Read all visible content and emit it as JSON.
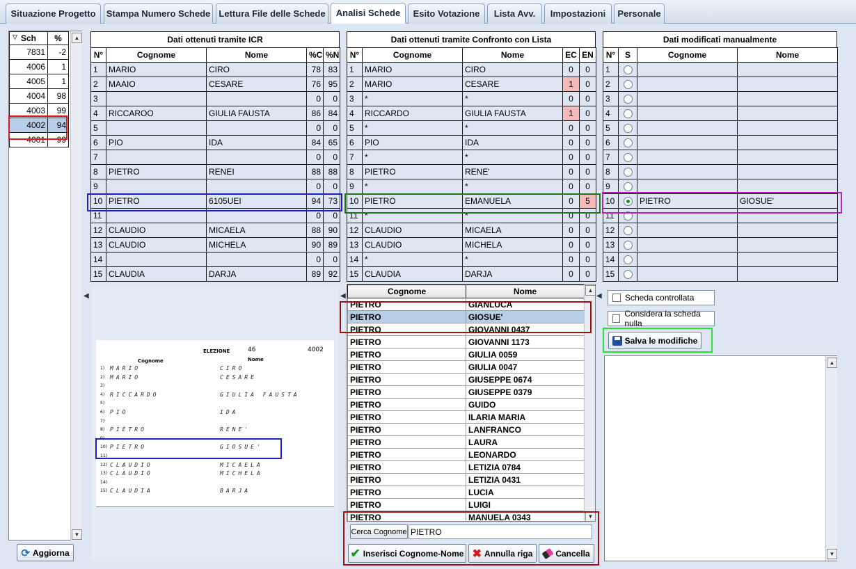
{
  "tabs": [
    "Situazione Progetto",
    "Stampa Numero Schede",
    "Lettura File delle Schede",
    "Analisi Schede",
    "Esito Votazione",
    "Lista Avv.",
    "Impostazioni",
    "Personale"
  ],
  "active_tab": "Analisi Schede",
  "left_list": {
    "headers": [
      "Sch",
      "%"
    ],
    "rows": [
      [
        "7831",
        "-2"
      ],
      [
        "4006",
        "1"
      ],
      [
        "4005",
        "1"
      ],
      [
        "4004",
        "98"
      ],
      [
        "4003",
        "99"
      ],
      [
        "4002",
        "94"
      ],
      [
        "4001",
        "99"
      ]
    ],
    "selected_index": 5,
    "refresh_label": "Aggiorna"
  },
  "icr": {
    "title": "Dati ottenuti tramite ICR",
    "headers": [
      "N°",
      "Cognome",
      "Nome",
      "%C",
      "%N"
    ],
    "rows": [
      [
        "1",
        "MARIO",
        "CIRO",
        "78",
        "83"
      ],
      [
        "2",
        "MAAIO",
        "CESARE",
        "76",
        "95"
      ],
      [
        "3",
        "",
        "",
        "0",
        "0"
      ],
      [
        "4",
        "RICCAROO",
        "GIULIA FAUSTA",
        "86",
        "84"
      ],
      [
        "5",
        "",
        "",
        "0",
        "0"
      ],
      [
        "6",
        "PIO",
        "IDA",
        "84",
        "65"
      ],
      [
        "7",
        "",
        "",
        "0",
        "0"
      ],
      [
        "8",
        "PIETRO",
        "RENEI",
        "88",
        "88"
      ],
      [
        "9",
        "",
        "",
        "0",
        "0"
      ],
      [
        "10",
        "PIETRO",
        "6105UEI",
        "94",
        "73"
      ],
      [
        "11",
        "",
        "",
        "0",
        "0"
      ],
      [
        "12",
        "CLAUDIO",
        "MICAELA",
        "88",
        "90"
      ],
      [
        "13",
        "CLAUDIO",
        "MICHELA",
        "90",
        "89"
      ],
      [
        "14",
        "",
        "",
        "0",
        "0"
      ],
      [
        "15",
        "CLAUDIA",
        "DARJA",
        "89",
        "92"
      ]
    ]
  },
  "scan": {
    "election_label": "ELEZIONE",
    "election_num": "46",
    "sheet_num": "4002",
    "col_cognome": "Cognome",
    "col_nome": "Nome",
    "lines": [
      [
        "1)",
        "MARIO",
        "CIRO"
      ],
      [
        "2)",
        "MARIO",
        "CESARE"
      ],
      [
        "3)",
        "",
        ""
      ],
      [
        "4)",
        "RICCARDO",
        "GIULIA FAUSTA"
      ],
      [
        "5)",
        "",
        ""
      ],
      [
        "6)",
        "PIO",
        "IDA"
      ],
      [
        "7)",
        "",
        ""
      ],
      [
        "8)",
        "PIETRO",
        "RENE'"
      ],
      [
        "9)",
        "",
        ""
      ],
      [
        "10)",
        "PIETRO",
        "GIOSUE'"
      ],
      [
        "11)",
        "",
        ""
      ],
      [
        "12)",
        "CLAUDIO",
        "MICAELA"
      ],
      [
        "13)",
        "CLAUDIO",
        "MICHELA"
      ],
      [
        "14)",
        "",
        ""
      ],
      [
        "15)",
        "CLAUDIA",
        "BARJA"
      ]
    ]
  },
  "compare": {
    "title": "Dati ottenuti tramite Confronto con Lista",
    "headers": [
      "N°",
      "Cognome",
      "Nome",
      "EC",
      "EN"
    ],
    "rows": [
      [
        "1",
        "MARIO",
        "CIRO",
        "0",
        "0"
      ],
      [
        "2",
        "MARIO",
        "CESARE",
        "1",
        "0"
      ],
      [
        "3",
        "*",
        "*",
        "0",
        "0"
      ],
      [
        "4",
        "RICCARDO",
        "GIULIA FAUSTA",
        "1",
        "0"
      ],
      [
        "5",
        "*",
        "*",
        "0",
        "0"
      ],
      [
        "6",
        "PIO",
        "IDA",
        "0",
        "0"
      ],
      [
        "7",
        "*",
        "*",
        "0",
        "0"
      ],
      [
        "8",
        "PIETRO",
        "RENE'",
        "0",
        "0"
      ],
      [
        "9",
        "*",
        "*",
        "0",
        "0"
      ],
      [
        "10",
        "PIETRO",
        "EMANUELA",
        "0",
        "5"
      ],
      [
        "11",
        "*",
        "*",
        "0",
        "0"
      ],
      [
        "12",
        "CLAUDIO",
        "MICAELA",
        "0",
        "0"
      ],
      [
        "13",
        "CLAUDIO",
        "MICHELA",
        "0",
        "0"
      ],
      [
        "14",
        "*",
        "*",
        "0",
        "0"
      ],
      [
        "15",
        "CLAUDIA",
        "DARJA",
        "0",
        "0"
      ]
    ]
  },
  "namelist": {
    "headers": [
      "Cognome",
      "Nome"
    ],
    "rows": [
      [
        "PIETRO",
        "GIANLUCA"
      ],
      [
        "PIETRO",
        "GIOSUE'"
      ],
      [
        "PIETRO",
        "GIOVANNI 0437"
      ],
      [
        "PIETRO",
        "GIOVANNI 1173"
      ],
      [
        "PIETRO",
        "GIULIA 0059"
      ],
      [
        "PIETRO",
        "GIULIA 0047"
      ],
      [
        "PIETRO",
        "GIUSEPPE 0674"
      ],
      [
        "PIETRO",
        "GIUSEPPE 0379"
      ],
      [
        "PIETRO",
        "GUIDO"
      ],
      [
        "PIETRO",
        "ILARIA MARIA"
      ],
      [
        "PIETRO",
        "LANFRANCO"
      ],
      [
        "PIETRO",
        "LAURA"
      ],
      [
        "PIETRO",
        "LEONARDO"
      ],
      [
        "PIETRO",
        "LETIZIA 0784"
      ],
      [
        "PIETRO",
        "LETIZIA 0431"
      ],
      [
        "PIETRO",
        "LUCIA"
      ],
      [
        "PIETRO",
        "LUIGI"
      ],
      [
        "PIETRO",
        "MANUELA 0343"
      ]
    ],
    "selected_index": 1,
    "search_button": "Cerca Cognome",
    "search_value": "PIETRO",
    "insert_button": "Inserisci Cognome-Nome",
    "cancel_row_button": "Annulla riga",
    "delete_button": "Cancella"
  },
  "manual": {
    "title": "Dati modificati manualmente",
    "headers": [
      "N°",
      "S",
      "Cognome",
      "Nome"
    ],
    "rows": [
      [
        "1",
        "",
        ""
      ],
      [
        "2",
        "",
        ""
      ],
      [
        "3",
        "",
        ""
      ],
      [
        "4",
        "",
        ""
      ],
      [
        "5",
        "",
        ""
      ],
      [
        "6",
        "",
        ""
      ],
      [
        "7",
        "",
        ""
      ],
      [
        "8",
        "",
        ""
      ],
      [
        "9",
        "",
        ""
      ],
      [
        "10",
        "PIETRO",
        "GIOSUE'"
      ],
      [
        "11",
        "",
        ""
      ],
      [
        "12",
        "",
        ""
      ],
      [
        "13",
        "",
        ""
      ],
      [
        "14",
        "",
        ""
      ],
      [
        "15",
        "",
        ""
      ]
    ],
    "selected_index": 9,
    "check1": "Scheda controllata",
    "check2": "Considera la scheda nulla",
    "save_button": "Salva le modifiche"
  },
  "colors": {
    "red": "#e01818",
    "blue": "#1a22b8",
    "green": "#1a7a1a",
    "magenta": "#c020c0",
    "lime": "#2ee02e",
    "darkred": "#a01010"
  }
}
